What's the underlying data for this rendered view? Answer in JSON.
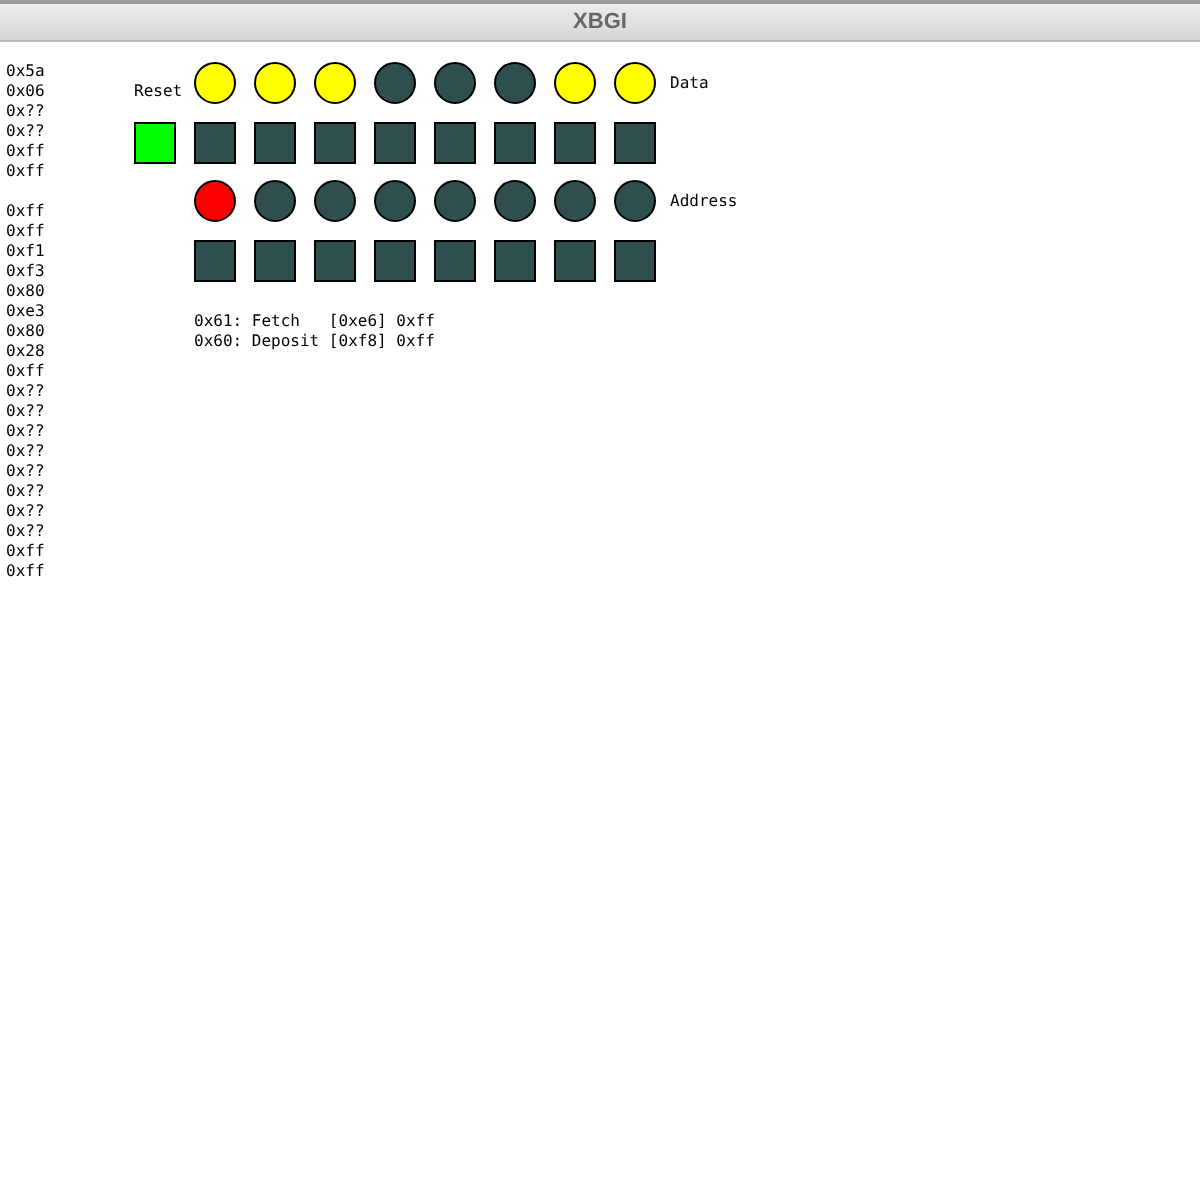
{
  "window": {
    "title": "XBGI"
  },
  "memory_blocks": [
    [
      "0x5a",
      "0x06",
      "0x??",
      "0x??",
      "0xff",
      "0xff"
    ],
    [
      "0xff",
      "0xff",
      "0xf1",
      "0xf3",
      "0x80",
      "0xe3",
      "0x80",
      "0x28",
      "0xff",
      "0x??",
      "0x??",
      "0x??",
      "0x??",
      "0x??",
      "0x??",
      "0x??",
      "0x??",
      "0xff",
      "0xff"
    ]
  ],
  "reset": {
    "label": "Reset",
    "on": true
  },
  "data": {
    "label": "Data",
    "leds": [
      {
        "on": true
      },
      {
        "on": true
      },
      {
        "on": true
      },
      {
        "on": false
      },
      {
        "on": false
      },
      {
        "on": false
      },
      {
        "on": true
      },
      {
        "on": true
      }
    ],
    "switches": [
      {
        "on": false
      },
      {
        "on": false
      },
      {
        "on": false
      },
      {
        "on": false
      },
      {
        "on": false
      },
      {
        "on": false
      },
      {
        "on": false
      },
      {
        "on": false
      }
    ]
  },
  "address": {
    "label": "Address",
    "leds": [
      {
        "on": true
      },
      {
        "on": false
      },
      {
        "on": false
      },
      {
        "on": false
      },
      {
        "on": false
      },
      {
        "on": false
      },
      {
        "on": false
      },
      {
        "on": false
      }
    ],
    "switches": [
      {
        "on": false
      },
      {
        "on": false
      },
      {
        "on": false
      },
      {
        "on": false
      },
      {
        "on": false
      },
      {
        "on": false
      },
      {
        "on": false
      },
      {
        "on": false
      }
    ]
  },
  "log": [
    "0x61: Fetch   [0xe6] 0xff",
    "0x60: Deposit [0xf8] 0xff"
  ]
}
